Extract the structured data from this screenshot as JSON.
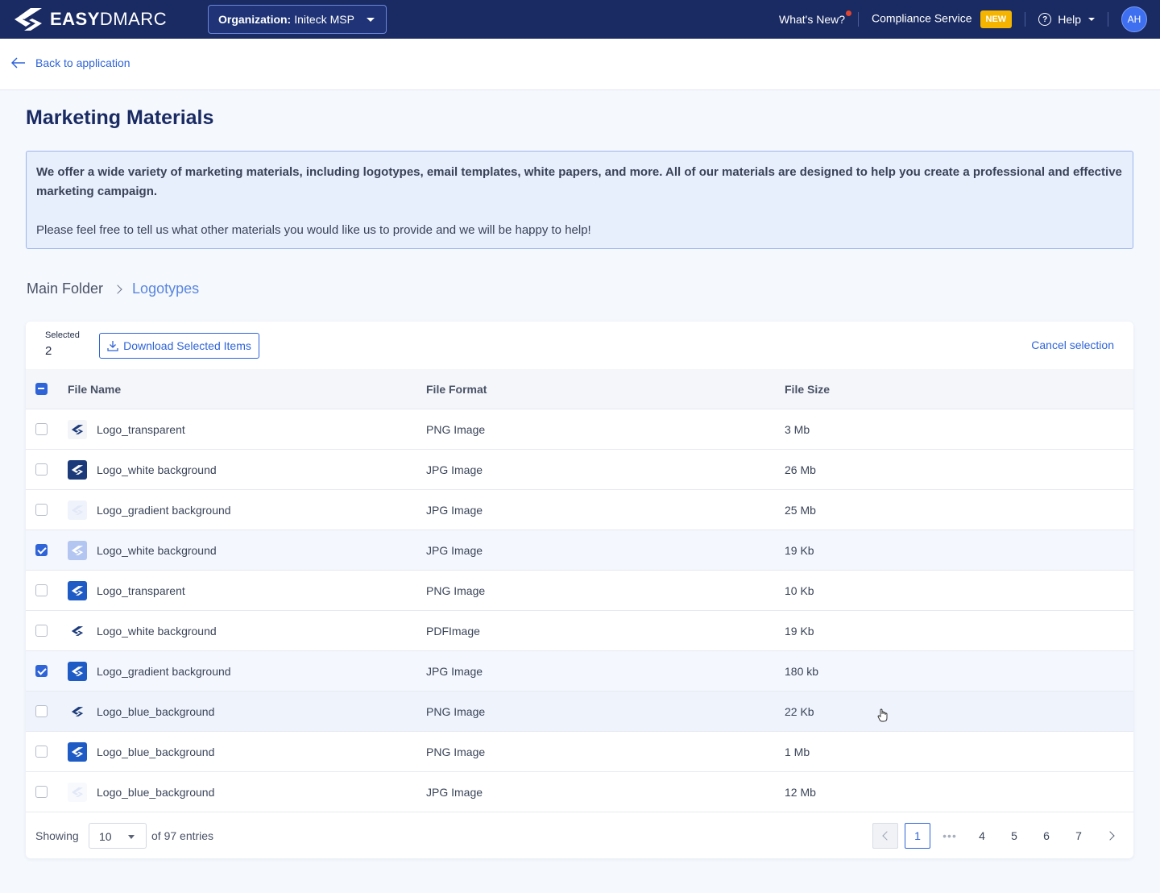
{
  "topbar": {
    "logo_bold": "EASY",
    "logo_rest": "DMARC",
    "org_label": "Organization:",
    "org_value": "Initeck MSP",
    "whats_new": "What's New?",
    "compliance": "Compliance Service",
    "new_badge": "NEW",
    "help": "Help",
    "avatar": "AH"
  },
  "back": {
    "label": "Back to application"
  },
  "page": {
    "title": "Marketing Materials"
  },
  "info": {
    "p1": "We offer a wide variety of marketing materials, including logotypes, email templates, white papers, and more. All of our materials are designed to help you create a professional and effective marketing campaign.",
    "p2": "Please feel free to tell us what other materials you would like us to provide and we will be happy to help!"
  },
  "breadcrumb": {
    "root": "Main Folder",
    "current": "Logotypes"
  },
  "selection": {
    "label": "Selected",
    "count": "2",
    "download": "Download Selected Items",
    "cancel": "Cancel selection"
  },
  "table": {
    "headers": {
      "name": "File Name",
      "format": "File Format",
      "size": "File Size"
    },
    "rows": [
      {
        "name": "Logo_transparent",
        "format": "PNG Image",
        "size": "3 Mb",
        "checked": false,
        "thumb": "t-white"
      },
      {
        "name": "Logo_white background",
        "format": "JPG Image",
        "size": "26 Mb",
        "checked": false,
        "thumb": "t-navy"
      },
      {
        "name": "Logo_gradient background",
        "format": "JPG Image",
        "size": "25 Mb",
        "checked": false,
        "thumb": "t-light"
      },
      {
        "name": "Logo_white background",
        "format": "JPG Image",
        "size": "19 Kb",
        "checked": true,
        "thumb": "t-lblue"
      },
      {
        "name": "Logo_transparent",
        "format": "PNG Image",
        "size": "10 Kb",
        "checked": false,
        "thumb": "t-blue"
      },
      {
        "name": "Logo_white background",
        "format": "PDFImage",
        "size": "19 Kb",
        "checked": false,
        "thumb": "t-none"
      },
      {
        "name": "Logo_gradient background",
        "format": "JPG Image",
        "size": "180 kb",
        "checked": true,
        "thumb": "t-blue"
      },
      {
        "name": "Logo_blue_background",
        "format": "PNG Image",
        "size": "22 Kb",
        "checked": false,
        "thumb": "t-none"
      },
      {
        "name": "Logo_blue_background",
        "format": "PNG Image",
        "size": "1 Mb",
        "checked": false,
        "thumb": "t-blue"
      },
      {
        "name": "Logo_blue_background",
        "format": "JPG Image",
        "size": "12 Mb",
        "checked": false,
        "thumb": "t-faint"
      }
    ]
  },
  "pagination": {
    "showing": "Showing",
    "per_page": "10",
    "of_entries": "of 97 entries",
    "pages": [
      "1",
      "•••",
      "4",
      "5",
      "6",
      "7"
    ],
    "active": "1"
  },
  "colors": {
    "navy": "#1a2b63",
    "accent": "#2f64d8",
    "badge": "#f4b400"
  },
  "icons": [
    "easydmarc-logo-icon",
    "chevron-down-icon",
    "help-circle-icon",
    "arrow-left-icon",
    "download-icon",
    "chevron-right-icon",
    "chevron-left-icon",
    "hand-cursor-icon"
  ]
}
